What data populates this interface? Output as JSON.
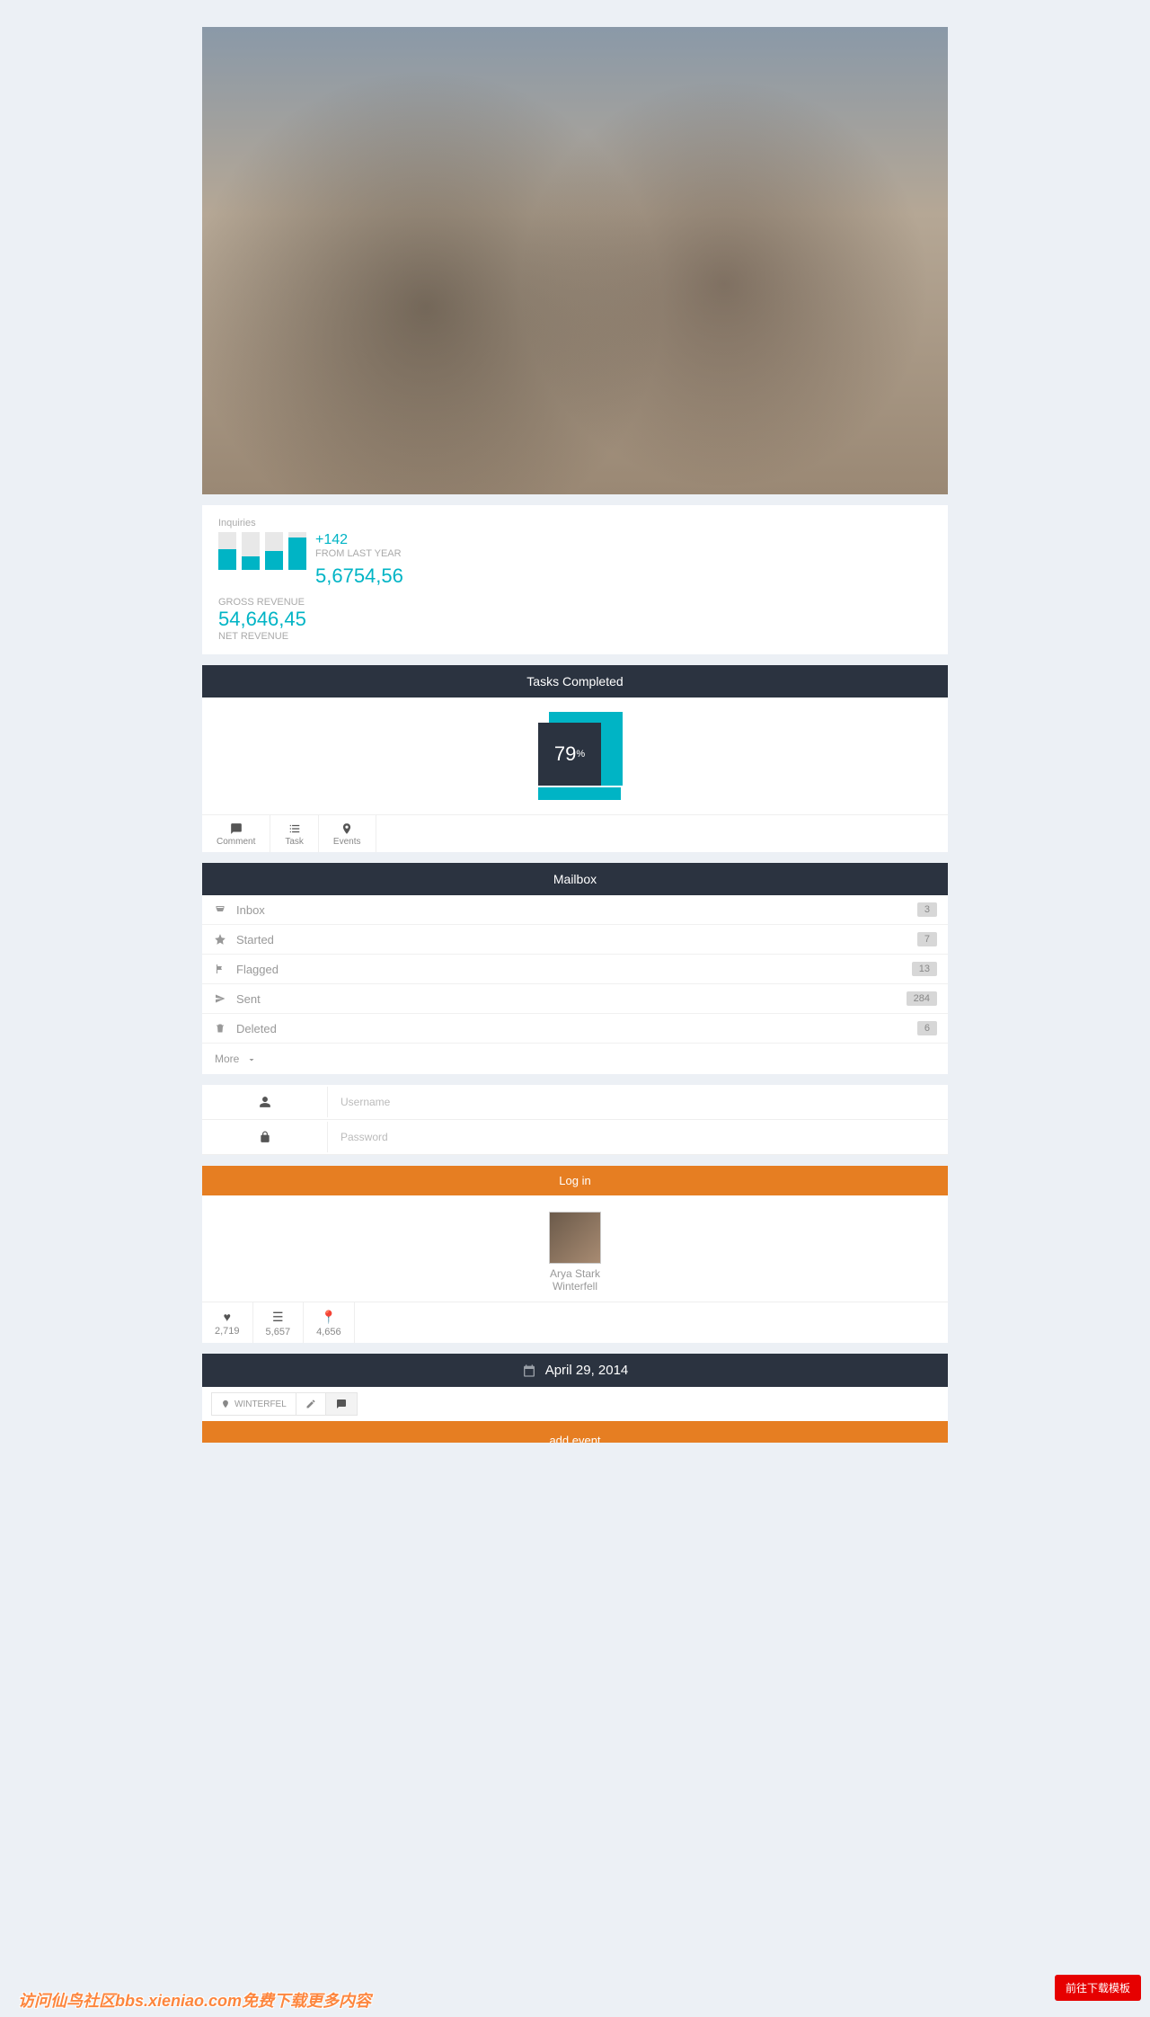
{
  "inquiries": {
    "label": "Inquiries",
    "bars": [
      55,
      35,
      50,
      85
    ],
    "delta": "+142",
    "delta_sub": "FROM LAST YEAR",
    "value": "5,6754,56"
  },
  "gross": {
    "label": "GROSS REVENUE",
    "value": "54,646,45",
    "sub": "NET REVENUE"
  },
  "tasks": {
    "title": "Tasks Completed",
    "percent": "79",
    "unit": "%"
  },
  "tabs": {
    "comment": "Comment",
    "task": "Task",
    "events": "Events"
  },
  "mailbox": {
    "title": "Mailbox",
    "items": [
      {
        "icon": "inbox",
        "label": "Inbox",
        "count": "3"
      },
      {
        "icon": "star",
        "label": "Started",
        "count": "7"
      },
      {
        "icon": "flag",
        "label": "Flagged",
        "count": "13"
      },
      {
        "icon": "send",
        "label": "Sent",
        "count": "284"
      },
      {
        "icon": "trash",
        "label": "Deleted",
        "count": "6"
      }
    ],
    "more": "More"
  },
  "login": {
    "username_ph": "Username",
    "password_ph": "Password",
    "button": "Log in"
  },
  "profile": {
    "name": "Arya Stark",
    "location": "Winterfell",
    "stats": {
      "likes": "2,719",
      "list": "5,657",
      "places": "4,656"
    }
  },
  "event": {
    "date": "April 29, 2014",
    "location": "WINTERFEL",
    "add": "add event"
  },
  "footer": {
    "download": "前往下载模板",
    "watermark": "访问仙鸟社区bbs.xieniao.com免费下载更多内容"
  }
}
